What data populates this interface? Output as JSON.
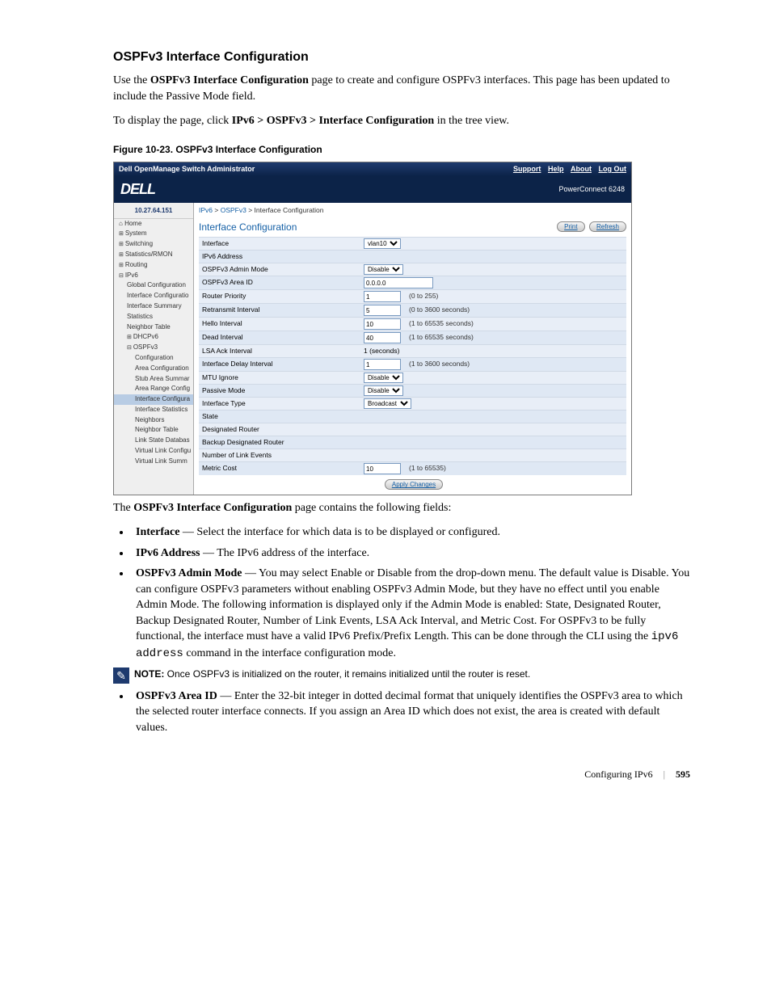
{
  "heading": "OSPFv3 Interface Configuration",
  "intro": {
    "p1_pre": "Use the ",
    "p1_bold": "OSPFv3 Interface Configuration",
    "p1_post": " page to create and configure OSPFv3 interfaces. This page has been updated to include the Passive Mode field.",
    "p2_pre": "To display the page, click ",
    "p2_bold": "IPv6 > OSPFv3 > Interface Configuration",
    "p2_post": " in the tree view."
  },
  "figure_caption": "Figure 10-23.    OSPFv3 Interface Configuration",
  "screenshot": {
    "title": "Dell OpenManage Switch Administrator",
    "top_links": [
      "Support",
      "Help",
      "About",
      "Log Out"
    ],
    "brand": "DELL",
    "model": "PowerConnect 6248",
    "ip": "10.27.64.151",
    "sidebar": {
      "home": "Home",
      "items_l1": [
        "System",
        "Switching",
        "Statistics/RMON",
        "Routing"
      ],
      "ipv6": "IPv6",
      "ipv6_children": [
        "Global Configuration",
        "Interface Configuratio",
        "Interface Summary",
        "Statistics",
        "Neighbor Table",
        "DHCPv6"
      ],
      "ospfv3": "OSPFv3",
      "ospfv3_children": [
        "Configuration",
        "Area Configuration",
        "Stub Area Summar",
        "Area Range Config",
        "Interface Configura",
        "Interface Statistics",
        "Neighbors",
        "Neighbor Table",
        "Link State Databas",
        "Virtual Link Configu",
        "Virtual Link Summ"
      ]
    },
    "breadcrumb": {
      "a": "IPv6",
      "b": "OSPFv3",
      "c": "Interface Configuration"
    },
    "page_title": "Interface Configuration",
    "buttons": {
      "print": "Print",
      "refresh": "Refresh",
      "apply": "Apply Changes"
    },
    "rows": [
      {
        "label": "Interface",
        "type": "select",
        "value": "vlan10"
      },
      {
        "label": "IPv6 Address",
        "type": "text",
        "value": ""
      },
      {
        "label": "OSPFv3 Admin Mode",
        "type": "select",
        "value": "Disable"
      },
      {
        "label": "OSPFv3 Area ID",
        "type": "input",
        "value": "0.0.0.0",
        "wide": true
      },
      {
        "label": "Router Priority",
        "type": "input",
        "value": "1",
        "hint": "(0 to 255)"
      },
      {
        "label": "Retransmit Interval",
        "type": "input",
        "value": "5",
        "hint": "(0 to 3600 seconds)"
      },
      {
        "label": "Hello Interval",
        "type": "input",
        "value": "10",
        "hint": "(1 to 65535 seconds)"
      },
      {
        "label": "Dead Interval",
        "type": "input",
        "value": "40",
        "hint": "(1 to 65535 seconds)"
      },
      {
        "label": "LSA Ack Interval",
        "type": "text",
        "value": "1  (seconds)"
      },
      {
        "label": "Interface Delay Interval",
        "type": "input",
        "value": "1",
        "hint": "(1 to 3600 seconds)"
      },
      {
        "label": "MTU Ignore",
        "type": "select",
        "value": "Disable"
      },
      {
        "label": "Passive Mode",
        "type": "select",
        "value": "Disable"
      },
      {
        "label": "Interface Type",
        "type": "select",
        "value": "Broadcast"
      },
      {
        "label": "State",
        "type": "text",
        "value": ""
      },
      {
        "label": "Designated Router",
        "type": "text",
        "value": ""
      },
      {
        "label": "Backup Designated Router",
        "type": "text",
        "value": ""
      },
      {
        "label": "Number of Link Events",
        "type": "text",
        "value": ""
      },
      {
        "label": "Metric Cost",
        "type": "input",
        "value": "10",
        "hint": "(1 to 65535)"
      }
    ]
  },
  "after_fig": {
    "pre": "The ",
    "bold": "OSPFv3 Interface Configuration",
    "post": " page contains the following fields:"
  },
  "fields": {
    "interface": {
      "name": "Interface",
      "desc": " — Select the interface for which data is to be displayed or configured."
    },
    "ipv6addr": {
      "name": "IPv6 Address",
      "desc": " — The IPv6 address of the interface."
    },
    "admin": {
      "name": "OSPFv3 Admin Mode",
      "desc_pre": " — You may select Enable or Disable from the drop-down menu. The default value is Disable. You can configure OSPFv3 parameters without enabling OSPFv3 Admin Mode, but they have no effect until you enable Admin Mode. The following information is displayed only if the Admin Mode is enabled: State, Designated Router, Backup Designated Router, Number of Link Events, LSA Ack Interval, and Metric Cost. For OSPFv3 to be fully functional, the interface must have a valid IPv6 Prefix/Prefix Length. This can be done through the CLI using the ",
      "cli": "ipv6 address",
      "desc_post": " command in the interface configuration mode."
    },
    "areaid": {
      "name": "OSPFv3 Area ID",
      "desc": " — Enter the 32-bit integer in dotted decimal format that uniquely identifies the OSPFv3 area to which the selected router interface connects. If you assign an Area ID which does not exist, the area is created with default values."
    }
  },
  "note": {
    "label": "NOTE:",
    "text": " Once OSPFv3 is initialized on the router, it remains initialized until the router is reset."
  },
  "footer": {
    "section": "Configuring IPv6",
    "page": "595"
  }
}
